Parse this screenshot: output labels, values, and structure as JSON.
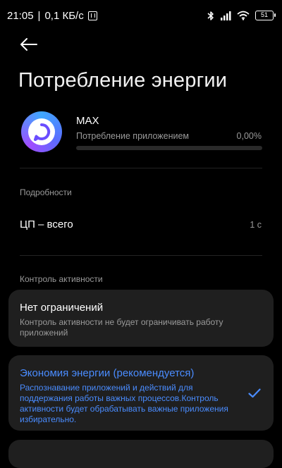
{
  "status_bar": {
    "time": "21:05",
    "separator": "|",
    "net_speed": "0,1 КБ/с",
    "battery": "51"
  },
  "page": {
    "title": "Потребление энергии"
  },
  "app": {
    "name": "MAX",
    "usage_label": "Потребление приложением",
    "usage_value": "0,00%",
    "usage_fraction": 0.0
  },
  "details": {
    "header": "Подробности",
    "cpu_label": "ЦП – всего",
    "cpu_value": "1 с"
  },
  "activity": {
    "header": "Контроль активности",
    "options": [
      {
        "title": "Нет ограничений",
        "desc": "Контроль активности не будет ограничивать работу приложений",
        "selected": false
      },
      {
        "title": "Экономия энергии (рекомендуется)",
        "desc": "Распознавание приложений и действий для поддержания работы важных процессов.Контроль активности будет обрабатывать важные приложения избирательно.",
        "selected": true
      }
    ]
  },
  "colors": {
    "accent": "#4a8cff",
    "background": "#000000",
    "card": "#1f1f1f",
    "secondary_text": "#9a9a9a"
  },
  "icons": [
    "back-arrow-icon",
    "nfc-icon",
    "bluetooth-icon",
    "signal-icon",
    "wifi-icon",
    "battery-icon",
    "app-logo-icon",
    "check-icon"
  ]
}
